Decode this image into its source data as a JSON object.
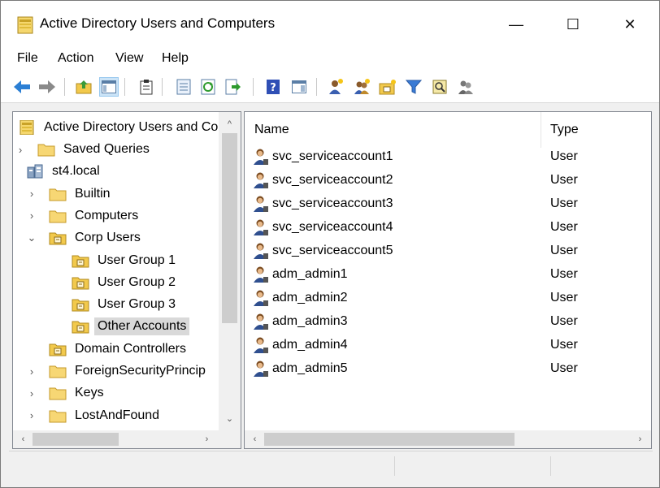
{
  "window": {
    "title": "Active Directory Users and Computers",
    "controls": {
      "minimize": "—",
      "maximize": "☐",
      "close": "✕"
    }
  },
  "menubar": {
    "items": [
      "File",
      "Action",
      "View",
      "Help"
    ]
  },
  "toolbar": {
    "buttons": [
      "back-arrow-icon",
      "forward-arrow-icon",
      "up-folder-icon",
      "show-console-tree-icon",
      "clipboard-icon",
      "properties-icon",
      "refresh-icon",
      "export-list-icon",
      "help-icon",
      "show-hide-action-pane-icon",
      "new-user-icon",
      "new-group-icon",
      "new-ou-icon",
      "filter-icon",
      "find-icon",
      "add-to-group-icon"
    ]
  },
  "tree": {
    "root": "Active Directory Users and Co",
    "items": [
      {
        "label": "Saved Queries",
        "expander": "›"
      },
      {
        "label": "st4.local",
        "expander": "⌄"
      },
      {
        "label": "Builtin",
        "expander": "›"
      },
      {
        "label": "Computers",
        "expander": "›"
      },
      {
        "label": "Corp Users",
        "expander": "⌄"
      },
      {
        "label": "User Group 1",
        "expander": ""
      },
      {
        "label": "User Group 2",
        "expander": ""
      },
      {
        "label": "User Group 3",
        "expander": ""
      },
      {
        "label": "Other Accounts",
        "expander": ""
      },
      {
        "label": "Domain Controllers",
        "expander": ""
      },
      {
        "label": "ForeignSecurityPrincip",
        "expander": "›"
      },
      {
        "label": "Keys",
        "expander": "›"
      },
      {
        "label": "LostAndFound",
        "expander": "›"
      }
    ],
    "selected": "Other Accounts"
  },
  "list": {
    "columns": {
      "name": "Name",
      "type": "Type"
    },
    "rows": [
      {
        "name": "svc_serviceaccount1",
        "type": "User"
      },
      {
        "name": "svc_serviceaccount2",
        "type": "User"
      },
      {
        "name": "svc_serviceaccount3",
        "type": "User"
      },
      {
        "name": "svc_serviceaccount4",
        "type": "User"
      },
      {
        "name": "svc_serviceaccount5",
        "type": "User"
      },
      {
        "name": "adm_admin1",
        "type": "User"
      },
      {
        "name": "adm_admin2",
        "type": "User"
      },
      {
        "name": "adm_admin3",
        "type": "User"
      },
      {
        "name": "adm_admin4",
        "type": "User"
      },
      {
        "name": "adm_admin5",
        "type": "User"
      }
    ]
  },
  "scroll": {
    "arrows": {
      "up": "^",
      "down": "⌄",
      "left": "‹",
      "right": "›"
    }
  },
  "colors": {
    "selection": "#d9d9d9",
    "folder": "#f2c94c",
    "pane_border": "#828790"
  }
}
